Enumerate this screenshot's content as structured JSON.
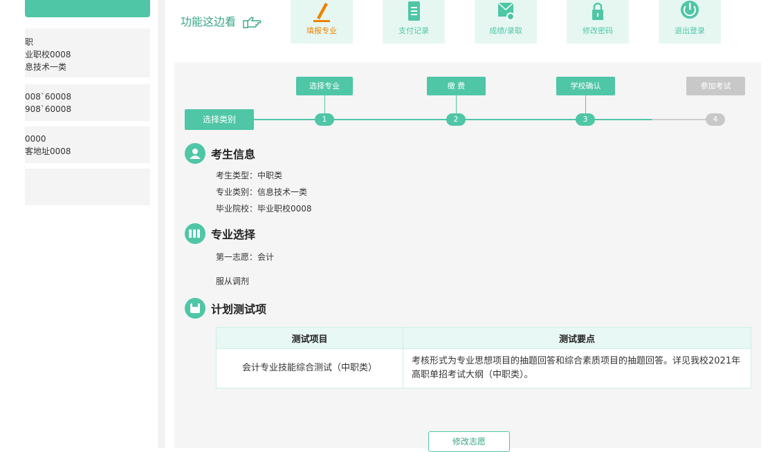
{
  "sidebar": {
    "card1": [
      "职",
      "业职校0008",
      "息技术一类"
    ],
    "card2": [
      "008`60008",
      "908`60008"
    ],
    "card3": [
      "0000",
      "客地址0008"
    ]
  },
  "header": {
    "slogan": "功能这边看",
    "nav": [
      {
        "label": "填报专业",
        "icon": "pencil-icon",
        "active": true
      },
      {
        "label": "支付记录",
        "icon": "clipboard-icon"
      },
      {
        "label": "成绩/录取",
        "icon": "mail-user-icon"
      },
      {
        "label": "修改密码",
        "icon": "lock-icon"
      },
      {
        "label": "退出登录",
        "icon": "power-icon"
      }
    ]
  },
  "steps": {
    "start": "选择类别",
    "items": [
      {
        "label": "选择专业",
        "num": "1"
      },
      {
        "label": "缴 费",
        "num": "2"
      },
      {
        "label": "学校确认",
        "num": "3"
      },
      {
        "label": "参加考试",
        "num": "4"
      }
    ]
  },
  "student": {
    "title": "考生信息",
    "type": "考生类型：中职类",
    "category": "专业类别：信息技术一类",
    "school": "毕业院校：毕业职校0008"
  },
  "major": {
    "title": "专业选择",
    "first_choice": "第一志愿：会计",
    "adjust": "服从调剂"
  },
  "plan": {
    "title": "计划测试项",
    "headers": [
      "测试项目",
      "测试要点"
    ],
    "row": [
      "会计专业技能综合测试（中职类）",
      "考核形式为专业思想项目的抽题回答和综合素质项目的抽题回答。详见我校2021年高职单招考试大纲（中职类）。"
    ]
  },
  "modify_button": "修改志愿",
  "colors": {
    "accent": "#4fc6a6",
    "active_nav": "#f08300",
    "disabled": "#c8c8c8"
  }
}
